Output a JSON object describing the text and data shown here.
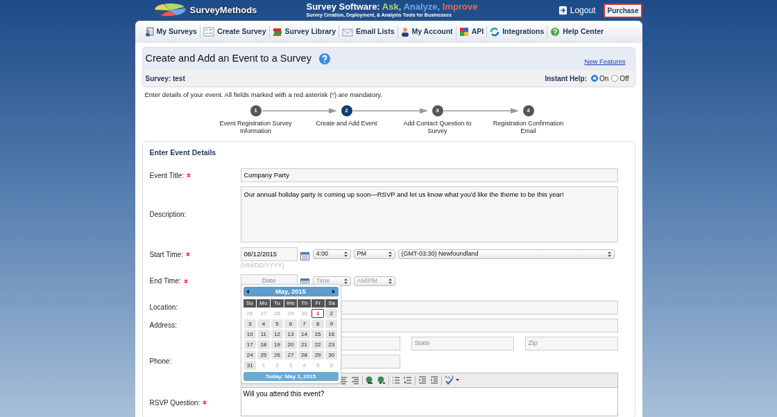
{
  "header": {
    "logo": "SurveyMethods",
    "tagline": "Survey Software: ",
    "tag_words": [
      {
        "text": "Ask,",
        "color": "#b5d96a"
      },
      {
        "text": "Analyze,",
        "color": "#6fa8e8"
      },
      {
        "text": "Improve",
        "color": "#f0645a"
      }
    ],
    "subtitle": "Survey Creation, Deployment, & Analysis Tools for Businesses",
    "logout": "Logout",
    "purchase": "Purchase"
  },
  "nav": [
    {
      "label": "My Surveys",
      "kind": "surveys"
    },
    {
      "label": "Create Survey",
      "kind": "create"
    },
    {
      "label": "Survey Library",
      "kind": "library"
    },
    {
      "label": "Email Lists",
      "kind": "email"
    },
    {
      "label": "My Account",
      "kind": "account"
    },
    {
      "label": "API",
      "kind": "api"
    },
    {
      "label": "Integrations",
      "kind": "integrations"
    },
    {
      "label": "Help Center",
      "kind": "help"
    }
  ],
  "page": {
    "title": "Create and Add an Event to a Survey",
    "new_features": "New Features",
    "survey": "Survey: test",
    "instant_help": "Instant Help:",
    "help_options": [
      {
        "label": "On",
        "selected": true
      },
      {
        "label": "Off",
        "selected": false
      }
    ],
    "instructions": "Enter details of your event. All fields marked with a red asterisk (*) are mandatory."
  },
  "steps": [
    {
      "number": "1",
      "label": "Event Registration Survey Information",
      "selected": false
    },
    {
      "number": "2",
      "label": "Create and Add Event",
      "selected": true
    },
    {
      "number": "3",
      "label": "Add Contact Question to Survey",
      "selected": false
    },
    {
      "number": "4",
      "label": "Registration Confirmation Email",
      "selected": false
    }
  ],
  "form": {
    "heading": "Enter Event Details",
    "event_title": {
      "label": "Event Title:",
      "required": true,
      "value": "Company Party"
    },
    "description": {
      "label": "Description:",
      "required": false,
      "value": "Our annual holiday party is coming up soon—RSVP and let us know what you'd like the theme to be this year!"
    },
    "start": {
      "label": "Start Time:",
      "required": true,
      "date": "08/12/2015",
      "time": "4:00",
      "ampm": "PM",
      "timezone": "(GMT-03:30) Newfoundland",
      "hint": "(MM/DD/YYYY)"
    },
    "end": {
      "label": "End Time:",
      "required": true,
      "date_placeholder": "Date",
      "time_placeholder": "Time",
      "ampm_placeholder": "AM/PM"
    },
    "location": {
      "label": "Location:",
      "required": false
    },
    "address": {
      "label": "Address:",
      "required": false,
      "state_placeholder": "State",
      "zip_placeholder": "Zip"
    },
    "phone": {
      "label": "Phone:",
      "required": false
    },
    "rsvp": {
      "label": "RSVP Question:",
      "required": true,
      "value": "Will you attend this event?"
    }
  },
  "calendar": {
    "month": "May, 2015",
    "weekdays": [
      "Su",
      "Mo",
      "Tu",
      "We",
      "Th",
      "Fr",
      "Sa"
    ],
    "weeks": [
      [
        {
          "day": "26",
          "muted": true,
          "today": false
        },
        {
          "day": "27",
          "muted": true,
          "today": false
        },
        {
          "day": "28",
          "muted": true,
          "today": false
        },
        {
          "day": "29",
          "muted": true,
          "today": false
        },
        {
          "day": "30",
          "muted": true,
          "today": false
        },
        {
          "day": "1",
          "muted": false,
          "today": true
        },
        {
          "day": "2",
          "muted": false,
          "today": false
        }
      ],
      [
        {
          "day": "3",
          "muted": false,
          "today": false
        },
        {
          "day": "4",
          "muted": false,
          "today": false
        },
        {
          "day": "5",
          "muted": false,
          "today": false
        },
        {
          "day": "6",
          "muted": false,
          "today": false
        },
        {
          "day": "7",
          "muted": false,
          "today": false
        },
        {
          "day": "8",
          "muted": false,
          "today": false
        },
        {
          "day": "9",
          "muted": false,
          "today": false
        }
      ],
      [
        {
          "day": "10",
          "muted": false,
          "today": false
        },
        {
          "day": "11",
          "muted": false,
          "today": false
        },
        {
          "day": "12",
          "muted": false,
          "today": false
        },
        {
          "day": "13",
          "muted": false,
          "today": false
        },
        {
          "day": "14",
          "muted": false,
          "today": false
        },
        {
          "day": "15",
          "muted": false,
          "today": false
        },
        {
          "day": "16",
          "muted": false,
          "today": false
        }
      ],
      [
        {
          "day": "17",
          "muted": false,
          "today": false
        },
        {
          "day": "18",
          "muted": false,
          "today": false
        },
        {
          "day": "19",
          "muted": false,
          "today": false
        },
        {
          "day": "20",
          "muted": false,
          "today": false
        },
        {
          "day": "21",
          "muted": false,
          "today": false
        },
        {
          "day": "22",
          "muted": false,
          "today": false
        },
        {
          "day": "23",
          "muted": false,
          "today": false
        }
      ],
      [
        {
          "day": "24",
          "muted": false,
          "today": false
        },
        {
          "day": "25",
          "muted": false,
          "today": false
        },
        {
          "day": "26",
          "muted": false,
          "today": false
        },
        {
          "day": "27",
          "muted": false,
          "today": false
        },
        {
          "day": "28",
          "muted": false,
          "today": false
        },
        {
          "day": "29",
          "muted": false,
          "today": false
        },
        {
          "day": "30",
          "muted": false,
          "today": false
        }
      ],
      [
        {
          "day": "31",
          "muted": false,
          "today": false
        },
        {
          "day": "1",
          "muted": true,
          "today": false
        },
        {
          "day": "2",
          "muted": true,
          "today": false
        },
        {
          "day": "3",
          "muted": true,
          "today": false
        },
        {
          "day": "4",
          "muted": true,
          "today": false
        },
        {
          "day": "5",
          "muted": true,
          "today": false
        },
        {
          "day": "6",
          "muted": true,
          "today": false
        }
      ]
    ],
    "today": "Today: May 1, 2015"
  }
}
